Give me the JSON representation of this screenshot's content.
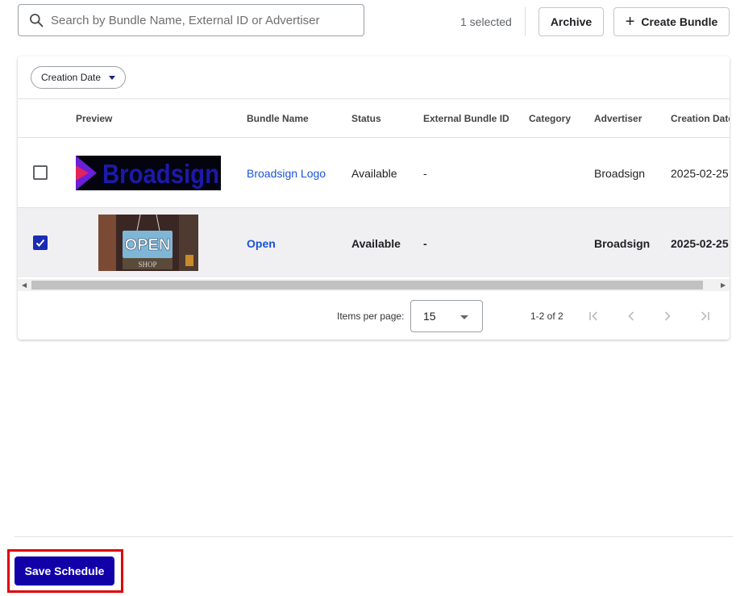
{
  "search": {
    "placeholder": "Search by Bundle Name, External ID or Advertiser",
    "value": ""
  },
  "toolbar": {
    "selected_text": "1 selected",
    "archive_label": "Archive",
    "create_label": "Create Bundle"
  },
  "filter": {
    "chip_label": "Creation Date"
  },
  "table": {
    "columns": [
      "Preview",
      "Bundle Name",
      "Status",
      "External Bundle ID",
      "Category",
      "Advertiser",
      "Creation Date"
    ],
    "rows": [
      {
        "preview": "Broadsign",
        "bundle_name": "Broadsign Logo",
        "status": "Available",
        "external_id": "-",
        "category": "",
        "advertiser": "Broadsign",
        "creation_date": "2025-02-25",
        "checked": false
      },
      {
        "preview": "OPEN",
        "preview_sub": "SHOP",
        "bundle_name": "Open",
        "status": "Available",
        "external_id": "-",
        "category": "",
        "advertiser": "Broadsign",
        "creation_date": "2025-02-25",
        "checked": true
      }
    ]
  },
  "pagination": {
    "items_per_page_label": "Items per page:",
    "items_per_page": "15",
    "range": "1-2 of 2"
  },
  "footer": {
    "save_label": "Save Schedule"
  },
  "colors": {
    "primary": "#1100a8",
    "link": "#1a53d6",
    "checkbox": "#1a2cb5",
    "highlight": "#e00000"
  }
}
